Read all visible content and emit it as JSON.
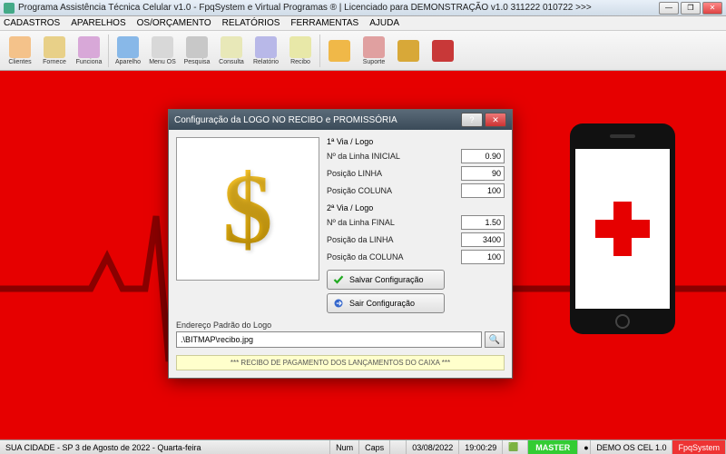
{
  "window": {
    "title": "Programa Assistência Técnica Celular v1.0 - FpqSystem e Virtual Programas ® | Licenciado para  DEMONSTRAÇÃO v1.0 311222 010722 >>>"
  },
  "menu": [
    "CADASTROS",
    "APARELHOS",
    "OS/ORÇAMENTO",
    "RELATÓRIOS",
    "FERRAMENTAS",
    "AJUDA"
  ],
  "toolbar": [
    {
      "label": "Clientes",
      "color": "#f4c28a"
    },
    {
      "label": "Fornece",
      "color": "#e8d088"
    },
    {
      "label": "Funciona",
      "color": "#d8a8d8"
    },
    {
      "label": "Aparelho",
      "color": "#88b8e8"
    },
    {
      "label": "Menu OS",
      "color": "#d8d8d8"
    },
    {
      "label": "Pesquisa",
      "color": "#c8c8c8"
    },
    {
      "label": "Consulta",
      "color": "#e8e8b8"
    },
    {
      "label": "Relatório",
      "color": "#b8b8e8"
    },
    {
      "label": "Recibo",
      "color": "#e8e8a8"
    },
    {
      "label": "",
      "color": "#f0b848"
    },
    {
      "label": "Suporte",
      "color": "#e0a0a0"
    },
    {
      "label": "",
      "color": "#d8a838"
    },
    {
      "label": "",
      "color": "#c83838"
    }
  ],
  "dialog": {
    "title": "Configuração da LOGO NO RECIBO e PROMISSÓRIA",
    "group1": "1ª Via / Logo",
    "f1_label": "Nº da Linha INICIAL",
    "f1_value": "0.90",
    "f2_label": "Posição LINHA",
    "f2_value": "90",
    "f3_label": "Posição COLUNA",
    "f3_value": "100",
    "group2": "2ª Via / Logo",
    "f4_label": "Nº da Linha FINAL",
    "f4_value": "1.50",
    "f5_label": "Posição da LINHA",
    "f5_value": "3400",
    "f6_label": "Posição da COLUNA",
    "f6_value": "100",
    "save_btn": "Salvar Configuração",
    "exit_btn": "Sair Configuração",
    "path_label": "Endereço Padrão do Logo",
    "path_value": ".\\BITMAP\\recibo.jpg",
    "footer": "*** RECIBO DE PAGAMENTO DOS LANÇAMENTOS DO CAIXA ***"
  },
  "statusbar": {
    "location": "SUA CIDADE - SP  3 de Agosto de 2022  -  Quarta-feira",
    "num": "Num",
    "caps": "Caps",
    "date": "03/08/2022",
    "time": "19:00:29",
    "user": "MASTER",
    "version": "DEMO OS CEL 1.0",
    "brand": "FpqSystem"
  }
}
